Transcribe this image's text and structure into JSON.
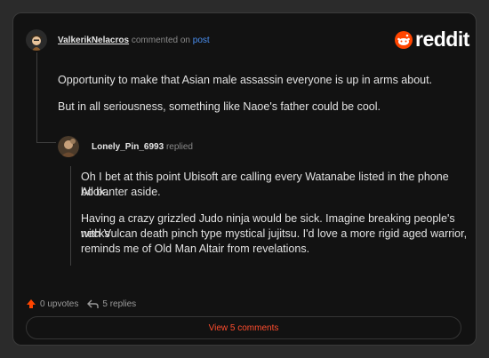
{
  "comment": {
    "author": "ValkerikNelacros",
    "action": "commented on",
    "link_text": "post",
    "paragraphs": [
      "Opportunity to make that Asian male assassin everyone is up in arms about.",
      "But in all seriousness, something like Naoe's father could be cool."
    ]
  },
  "reply": {
    "author": "Lonely_Pin_6993",
    "action": "replied",
    "paragraph1_lines": [
      "Oh I bet at this point Ubisoft are calling every Watanabe listed in the phone book.",
      "All banter aside."
    ],
    "paragraph2_lines": [
      "Having a crazy grizzled Judo ninja would be sick.   Imagine breaking people's necks",
      "with Vulcan death pinch type mystical jujitsu. I'd love a more rigid aged warrior,",
      "reminds me of Old Man Altair from revelations."
    ]
  },
  "brand": {
    "name": "reddit",
    "color": "#ff4500"
  },
  "footer": {
    "upvotes": "0 upvotes",
    "replies": "5 replies",
    "view_comments": "View 5 comments"
  },
  "icons": [
    "avatar-pirate",
    "avatar-photo",
    "reddit-snoo-icon",
    "upvote-arrow-icon",
    "reply-arrow-icon"
  ]
}
